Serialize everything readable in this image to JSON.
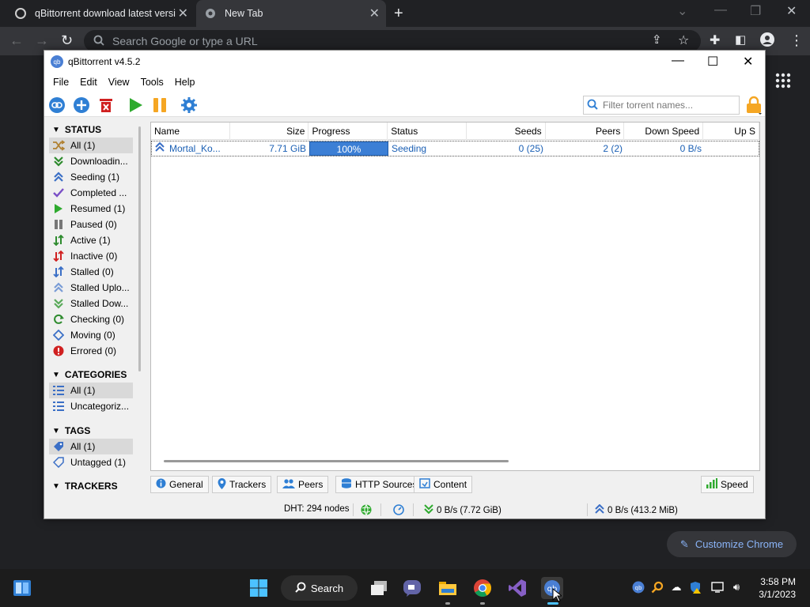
{
  "browser": {
    "tabs": [
      {
        "label": "qBittorrent download latest versi"
      },
      {
        "label": "New Tab"
      }
    ],
    "omnibox_placeholder": "Search Google or type a URL",
    "customize_label": "Customize Chrome"
  },
  "qbittorrent": {
    "title": "qBittorrent v4.5.2",
    "menu": [
      "File",
      "Edit",
      "View",
      "Tools",
      "Help"
    ],
    "filter_placeholder": "Filter torrent names...",
    "sidebar": {
      "status_header": "STATUS",
      "status_items": [
        {
          "label": "All (1)",
          "icon": "shuffle-icon",
          "color": "#b08030"
        },
        {
          "label": "Downloadin...",
          "icon": "double-chevron-down-icon",
          "color": "#2e8b2e"
        },
        {
          "label": "Seeding (1)",
          "icon": "double-chevron-up-icon",
          "color": "#3b6fc6"
        },
        {
          "label": "Completed ...",
          "icon": "checkmark-icon",
          "color": "#7a4fc6"
        },
        {
          "label": "Resumed (1)",
          "icon": "play-icon",
          "color": "#2eaa2e"
        },
        {
          "label": "Paused (0)",
          "icon": "pause-icon",
          "color": "#777777"
        },
        {
          "label": "Active (1)",
          "icon": "updown-arrows-icon",
          "color": "#2e8b2e"
        },
        {
          "label": "Inactive (0)",
          "icon": "updown-arrows-icon",
          "color": "#d02020"
        },
        {
          "label": "Stalled (0)",
          "icon": "updown-arrows-icon",
          "color": "#3b6fc6"
        },
        {
          "label": "Stalled Uplo...",
          "icon": "double-chevron-up-icon",
          "color": "#7a9cd6"
        },
        {
          "label": "Stalled Dow...",
          "icon": "double-chevron-down-icon",
          "color": "#5aaa5a"
        },
        {
          "label": "Checking (0)",
          "icon": "refresh-icon",
          "color": "#2e8b2e"
        },
        {
          "label": "Moving (0)",
          "icon": "move-icon",
          "color": "#3b6fc6"
        },
        {
          "label": "Errored (0)",
          "icon": "error-icon",
          "color": "#d02020"
        }
      ],
      "categories_header": "CATEGORIES",
      "category_items": [
        {
          "label": "All (1)"
        },
        {
          "label": "Uncategoriz..."
        }
      ],
      "tags_header": "TAGS",
      "tag_items": [
        {
          "label": "All (1)"
        },
        {
          "label": "Untagged (1)"
        }
      ],
      "trackers_header": "TRACKERS"
    },
    "table": {
      "columns": [
        "Name",
        "Size",
        "Progress",
        "Status",
        "Seeds",
        "Peers",
        "Down Speed",
        "Up S"
      ],
      "rows": [
        {
          "name": "Mortal_Ko...",
          "size": "7.71 GiB",
          "progress": "100%",
          "progress_value": 1.0,
          "status": "Seeding",
          "seeds": "0 (25)",
          "peers": "2 (2)",
          "down_speed": "0 B/s"
        }
      ]
    },
    "panel_tabs": [
      "General",
      "Trackers",
      "Peers",
      "HTTP Sources",
      "Content"
    ],
    "speed_label": "Speed",
    "statusbar": {
      "dht": "DHT: 294 nodes",
      "download": "0 B/s (7.72 GiB)",
      "upload": "0 B/s (413.2 MiB)"
    }
  },
  "taskbar": {
    "search_label": "Search",
    "time": "3:58 PM",
    "date": "3/1/2023"
  }
}
